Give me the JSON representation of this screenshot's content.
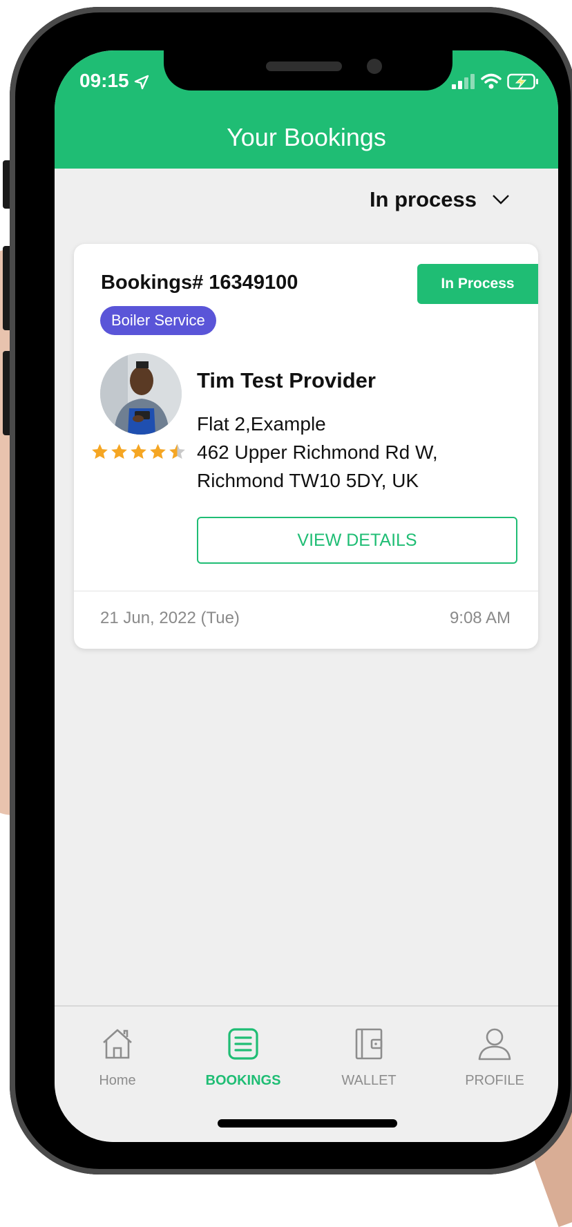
{
  "status_bar": {
    "time": "09:15"
  },
  "header": {
    "title": "Your Bookings"
  },
  "filter": {
    "selected": "In process"
  },
  "booking": {
    "number": "Bookings# 16349100",
    "status": "In Process",
    "service": "Boiler Service",
    "provider_name": "Tim Test Provider",
    "rating": 4.5,
    "address_lines": [
      "Flat 2,Example",
      "462 Upper Richmond Rd W,",
      "Richmond TW10 5DY,  UK"
    ],
    "view_button": "VIEW DETAILS",
    "date": "21 Jun, 2022 (Tue)",
    "time": "9:08 AM"
  },
  "nav": {
    "active": "BOOKINGS",
    "items": [
      {
        "label": "Home",
        "icon": "home-icon"
      },
      {
        "label": "BOOKINGS",
        "icon": "bookings-icon"
      },
      {
        "label": "WALLET",
        "icon": "wallet-icon"
      },
      {
        "label": "PROFILE",
        "icon": "profile-icon"
      }
    ]
  },
  "colors": {
    "primary": "#1fbd74",
    "service_tag": "#5a55d8",
    "star": "#f5a623"
  }
}
